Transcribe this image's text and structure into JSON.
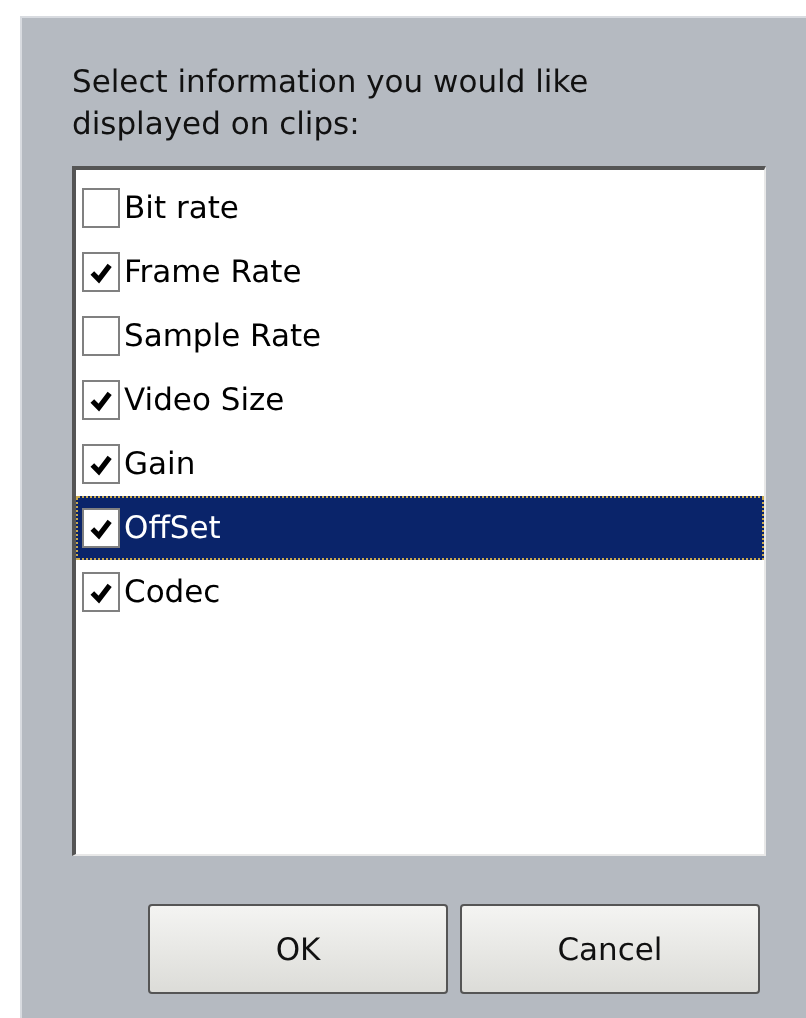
{
  "prompt": "Select information you would like displayed on clips:",
  "options": [
    {
      "label": "Bit rate",
      "checked": false,
      "selected": false
    },
    {
      "label": "Frame Rate",
      "checked": true,
      "selected": false
    },
    {
      "label": "Sample Rate",
      "checked": false,
      "selected": false
    },
    {
      "label": "Video Size",
      "checked": true,
      "selected": false
    },
    {
      "label": "Gain",
      "checked": true,
      "selected": false
    },
    {
      "label": "OffSet",
      "checked": true,
      "selected": true
    },
    {
      "label": "Codec",
      "checked": true,
      "selected": false
    }
  ],
  "buttons": [
    "OK",
    "Cancel"
  ]
}
